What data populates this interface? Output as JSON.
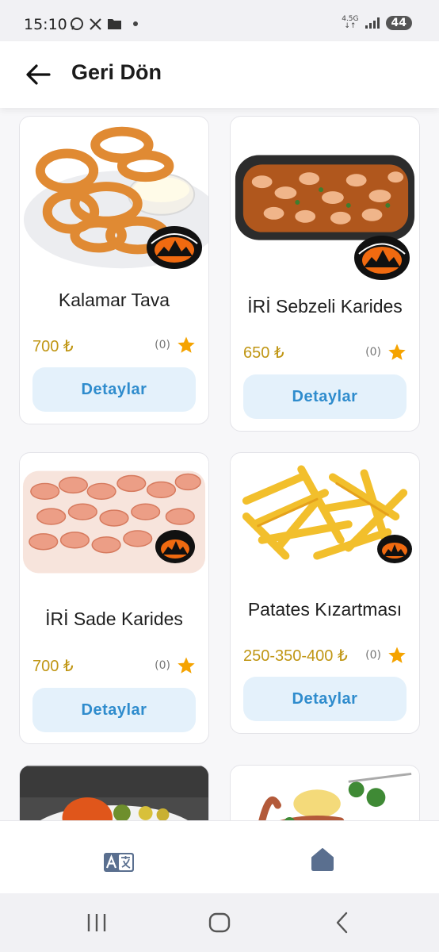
{
  "status_bar": {
    "time": "15:10",
    "network_label": "4.5G",
    "battery": "44"
  },
  "header": {
    "title": "Geri Dön"
  },
  "products": [
    {
      "name": "Kalamar Tava",
      "price": "700 ₺",
      "rating_count": "(0)",
      "button_label": "Detaylar"
    },
    {
      "name": "İRİ Sebzeli Karides",
      "price": "650 ₺",
      "rating_count": "(0)",
      "button_label": "Detaylar"
    },
    {
      "name": "İRİ Sade Karides",
      "price": "700 ₺",
      "rating_count": "(0)",
      "button_label": "Detaylar"
    },
    {
      "name": "Patates Kızartması",
      "price": "250-350-400 ₺",
      "rating_count": "(0)",
      "button_label": "Detaylar"
    }
  ],
  "bottom_nav": [
    {
      "icon": "translate-icon"
    },
    {
      "icon": "home-icon"
    }
  ],
  "colors": {
    "price": "#c09614",
    "star": "#f5a300",
    "button_bg": "#e4f1fb",
    "button_text": "#2f8ccd",
    "home_icon": "#5a6f8f"
  }
}
